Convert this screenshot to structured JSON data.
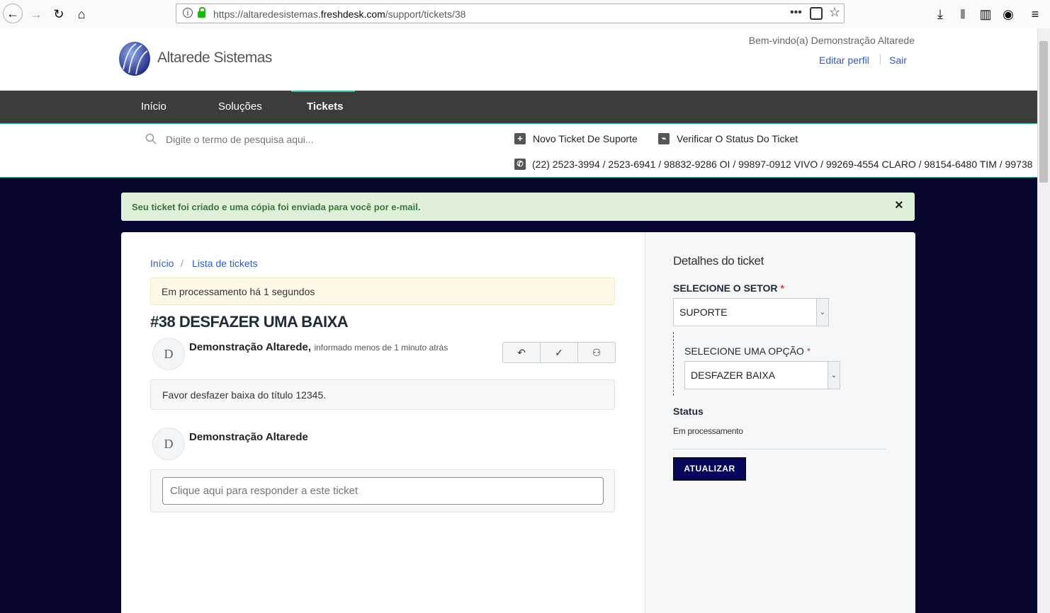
{
  "browser": {
    "url_prefix": "https://altaredesistemas.",
    "url_domain": "freshdesk.com",
    "url_path": "/support/tickets/38"
  },
  "header": {
    "brand": "Altarede Sistemas",
    "welcome": "Bem-vindo(a) Demonstração Altarede",
    "edit_profile": "Editar perfil",
    "logout": "Sair"
  },
  "nav": {
    "items": [
      "Início",
      "Soluções",
      "Tickets"
    ],
    "active": "Tickets",
    "active_color": "#2bbfa0"
  },
  "search": {
    "placeholder": "Digite o termo de pesquisa aqui...",
    "new_ticket": "Novo Ticket De Suporte",
    "check_status": "Verificar O Status Do Ticket",
    "phones": "(22) 2523-3994 / 2523-6941 / 98832-9286 OI / 99897-0912 VIVO / 99269-4554 CLARO / 98154-6480 TIM / 99738"
  },
  "alert": {
    "message": "Seu ticket foi criado e uma cópia foi enviada para você por e-mail.",
    "close": "×"
  },
  "breadcrumb": {
    "home": "Início",
    "separator": "/",
    "list": "Lista de tickets"
  },
  "ticket": {
    "status_banner": "Em processamento há 1 segundos",
    "title": "#38 DESFAZER UMA BAIXA",
    "author": "Demonstração Altarede,",
    "time": "informado menos de 1 minuto atrás",
    "avatar_letter": "D",
    "body": "Favor desfazer baixa do título 12345.",
    "reply_author": "Demonstração Altarede",
    "reply_placeholder": "Clique aqui para responder a este ticket"
  },
  "sidebar": {
    "heading": "Detalhes do ticket",
    "sector_label": "SELECIONE O SETOR",
    "sector_value": "SUPORTE",
    "option_label": "SELECIONE UMA OPÇÃO",
    "option_value": "DESFAZER BAIXA",
    "required_mark": "*",
    "status_label": "Status",
    "status_value": "Em processamento",
    "update_button": "ATUALIZAR",
    "button_color": "#06065a"
  }
}
